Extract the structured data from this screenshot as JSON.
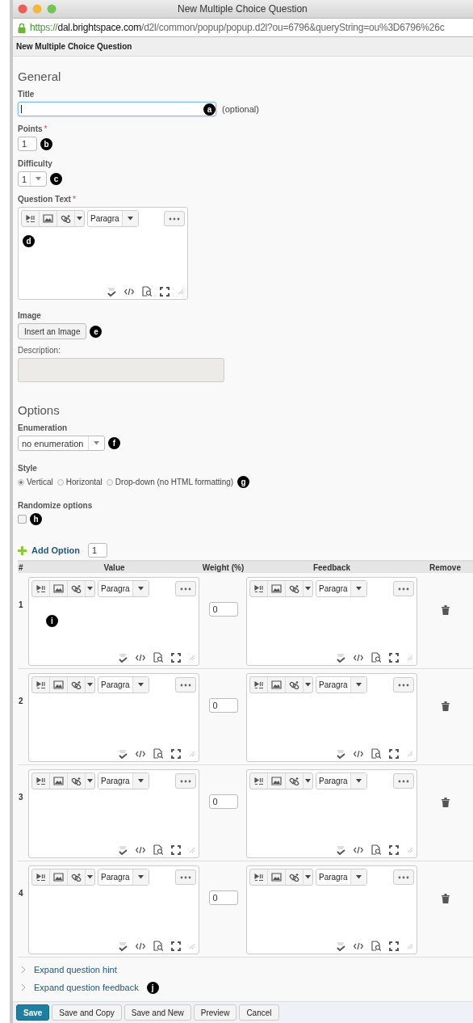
{
  "window": {
    "title": "New Multiple Choice Question"
  },
  "address_bar": {
    "scheme": "https://",
    "host": "dal.brightspace.com",
    "path": "/d2l/common/popup/popup.d2l?ou=6796&queryString=ou%3D6796%26c"
  },
  "page_title": "New Multiple Choice Question",
  "general": {
    "heading": "General",
    "title": {
      "label": "Title",
      "focused": true,
      "marker": "a",
      "note": "(optional)"
    },
    "points": {
      "label": "Points",
      "required_mark": "*",
      "value": "1",
      "marker": "b"
    },
    "difficulty": {
      "label": "Difficulty",
      "value": "1",
      "marker": "c"
    },
    "question_text": {
      "label": "Question Text",
      "required_mark": "*",
      "format": "Paragra",
      "marker": "d"
    },
    "image": {
      "label": "Image",
      "button": "Insert an Image",
      "marker": "e",
      "description_label": "Description:",
      "description_disabled": true
    }
  },
  "options": {
    "heading": "Options",
    "enumeration": {
      "label": "Enumeration",
      "value": "no enumeration",
      "marker": "f"
    },
    "style": {
      "label": "Style",
      "marker": "g",
      "choices": [
        {
          "label": "Vertical",
          "selected": true
        },
        {
          "label": "Horizontal",
          "selected": false
        },
        {
          "label": "Drop-down (no HTML formatting)",
          "selected": false
        }
      ]
    },
    "randomize": {
      "label": "Randomize options",
      "checked": false,
      "marker": "h"
    },
    "add_option": {
      "label": "Add Option",
      "count": "1"
    }
  },
  "table": {
    "columns": [
      "#",
      "Value",
      "Weight (%)",
      "Feedback",
      "Remove"
    ],
    "rows": [
      {
        "number": "1",
        "value_format": "Paragra",
        "weight": "0",
        "feedback_format": "Paragra",
        "marker": "i"
      },
      {
        "number": "2",
        "value_format": "Paragra",
        "weight": "0",
        "feedback_format": "Paragra"
      },
      {
        "number": "3",
        "value_format": "Paragra",
        "weight": "0",
        "feedback_format": "Paragra"
      },
      {
        "number": "4",
        "value_format": "Paragra",
        "weight": "0",
        "feedback_format": "Paragra"
      }
    ]
  },
  "expanders": [
    {
      "label": "Expand question hint"
    },
    {
      "label": "Expand question feedback",
      "marker": "j"
    }
  ],
  "buttons": [
    {
      "label": "Save",
      "primary": true
    },
    {
      "label": "Save and Copy",
      "primary": false
    },
    {
      "label": "Save and New",
      "primary": false
    },
    {
      "label": "Preview",
      "primary": false
    },
    {
      "label": "Cancel",
      "primary": false
    }
  ]
}
